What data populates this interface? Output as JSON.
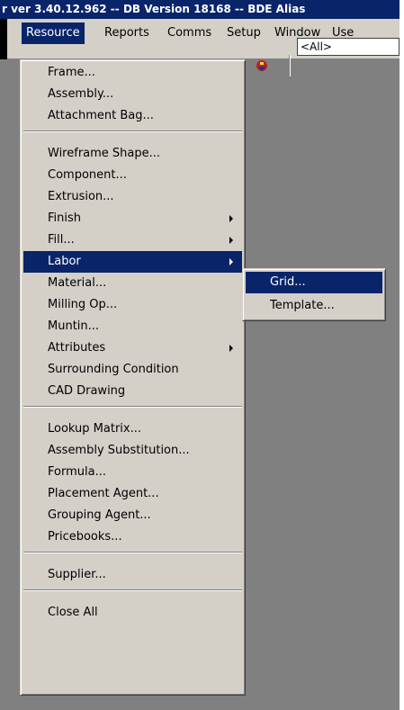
{
  "window": {
    "title": "r ver 3.40.12.962 -- DB Version 18168 -- BDE Alias"
  },
  "menubar": {
    "items": [
      "Resource",
      "Reports",
      "Comms",
      "Setup",
      "Window",
      "Use"
    ]
  },
  "toolbar": {
    "combo_value": "<All>"
  },
  "resource_menu": {
    "items": [
      "Frame...",
      "Assembly...",
      "Attachment Bag...",
      "Wireframe Shape...",
      "Component...",
      "Extrusion...",
      "Finish",
      "Fill...",
      "Labor",
      "Material...",
      "Milling Op...",
      "Muntin...",
      "Attributes",
      "Surrounding Condition",
      "CAD Drawing",
      "Lookup Matrix...",
      "Assembly Substitution...",
      "Formula...",
      "Placement Agent...",
      "Grouping Agent...",
      "Pricebooks...",
      "Supplier...",
      "Close All"
    ]
  },
  "labor_submenu": {
    "items": [
      "Grid...",
      "Template..."
    ]
  },
  "colors": {
    "highlight": "#0a246a",
    "menu_bg": "#d4d0c8",
    "workspace": "#808080"
  }
}
